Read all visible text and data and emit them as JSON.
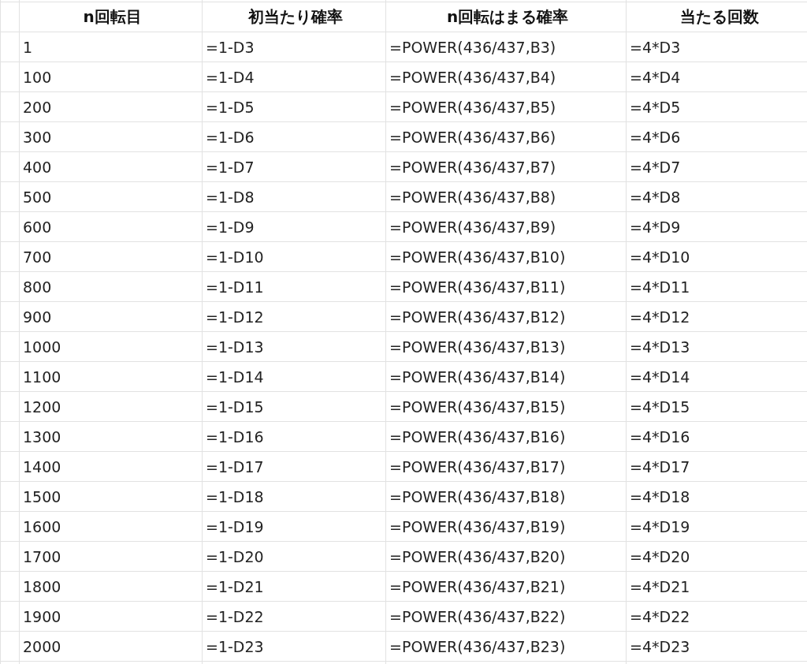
{
  "table": {
    "columns": [
      "n回転目",
      "初当たり確率",
      "n回転はまる確率",
      "当たる回数"
    ],
    "rows": [
      [
        "1",
        "=1-D3",
        "=POWER(436/437,B3)",
        "=4*D3"
      ],
      [
        "100",
        "=1-D4",
        "=POWER(436/437,B4)",
        "=4*D4"
      ],
      [
        "200",
        "=1-D5",
        "=POWER(436/437,B5)",
        "=4*D5"
      ],
      [
        "300",
        "=1-D6",
        "=POWER(436/437,B6)",
        "=4*D6"
      ],
      [
        "400",
        "=1-D7",
        "=POWER(436/437,B7)",
        "=4*D7"
      ],
      [
        "500",
        "=1-D8",
        "=POWER(436/437,B8)",
        "=4*D8"
      ],
      [
        "600",
        "=1-D9",
        "=POWER(436/437,B9)",
        "=4*D9"
      ],
      [
        "700",
        "=1-D10",
        "=POWER(436/437,B10)",
        "=4*D10"
      ],
      [
        "800",
        "=1-D11",
        "=POWER(436/437,B11)",
        "=4*D11"
      ],
      [
        "900",
        "=1-D12",
        "=POWER(436/437,B12)",
        "=4*D12"
      ],
      [
        "1000",
        "=1-D13",
        "=POWER(436/437,B13)",
        "=4*D13"
      ],
      [
        "1100",
        "=1-D14",
        "=POWER(436/437,B14)",
        "=4*D14"
      ],
      [
        "1200",
        "=1-D15",
        "=POWER(436/437,B15)",
        "=4*D15"
      ],
      [
        "1300",
        "=1-D16",
        "=POWER(436/437,B16)",
        "=4*D16"
      ],
      [
        "1400",
        "=1-D17",
        "=POWER(436/437,B17)",
        "=4*D17"
      ],
      [
        "1500",
        "=1-D18",
        "=POWER(436/437,B18)",
        "=4*D18"
      ],
      [
        "1600",
        "=1-D19",
        "=POWER(436/437,B19)",
        "=4*D19"
      ],
      [
        "1700",
        "=1-D20",
        "=POWER(436/437,B20)",
        "=4*D20"
      ],
      [
        "1800",
        "=1-D21",
        "=POWER(436/437,B21)",
        "=4*D21"
      ],
      [
        "1900",
        "=1-D22",
        "=POWER(436/437,B22)",
        "=4*D22"
      ],
      [
        "2000",
        "=1-D23",
        "=POWER(436/437,B23)",
        "=4*D23"
      ]
    ]
  }
}
